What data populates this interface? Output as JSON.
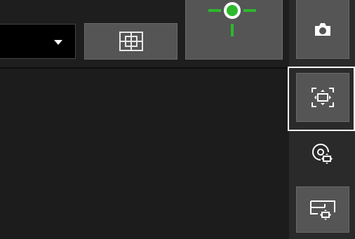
{
  "toolbar": {
    "dropdown": {
      "value": ""
    },
    "grid_button": {
      "icon": "grid-layout-icon"
    },
    "focus_target_button": {
      "icon": "focus-target-icon",
      "accent": "#2db82d"
    }
  },
  "sidebar": {
    "buttons": [
      {
        "name": "camera",
        "icon": "camera-icon",
        "selected": false
      },
      {
        "name": "fit-view",
        "icon": "fit-view-icon",
        "selected": true
      },
      {
        "name": "rotate-view",
        "icon": "rotate-view-icon",
        "selected": false
      },
      {
        "name": "pan-view",
        "icon": "pan-view-icon",
        "selected": false
      }
    ]
  },
  "colors": {
    "background": "#1c1c1c",
    "button": "#555555",
    "sidebar": "#2a2a2a",
    "accent_green": "#2db82d",
    "selection": "#ffffff"
  }
}
